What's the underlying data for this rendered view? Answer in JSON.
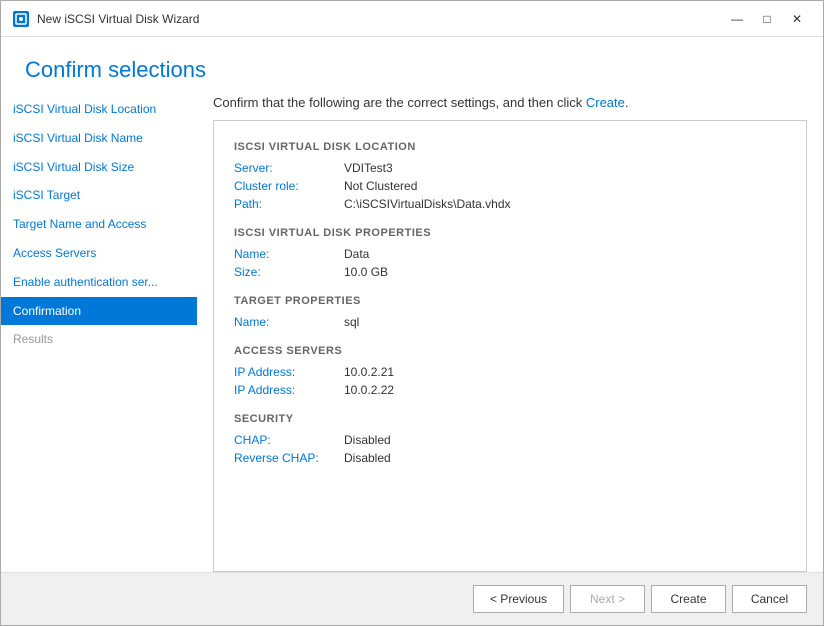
{
  "window": {
    "title": "New iSCSI Virtual Disk Wizard",
    "icon": "💾"
  },
  "header": {
    "title": "Confirm selections"
  },
  "instruction": {
    "text": "Confirm that the following are the correct settings, and then click ",
    "link_text": "Create",
    "text_end": "."
  },
  "sidebar": {
    "items": [
      {
        "id": "iscsi-virtual-disk-location",
        "label": "iSCSI Virtual Disk Location",
        "state": "normal"
      },
      {
        "id": "iscsi-virtual-disk-name",
        "label": "iSCSI Virtual Disk Name",
        "state": "normal"
      },
      {
        "id": "iscsi-virtual-disk-size",
        "label": "iSCSI Virtual Disk Size",
        "state": "normal"
      },
      {
        "id": "iscsi-target",
        "label": "iSCSI Target",
        "state": "normal"
      },
      {
        "id": "target-name-and-access",
        "label": "Target Name and Access",
        "state": "normal"
      },
      {
        "id": "access-servers",
        "label": "Access Servers",
        "state": "normal"
      },
      {
        "id": "enable-authentication",
        "label": "Enable authentication ser...",
        "state": "normal"
      },
      {
        "id": "confirmation",
        "label": "Confirmation",
        "state": "active"
      },
      {
        "id": "results",
        "label": "Results",
        "state": "inactive"
      }
    ]
  },
  "summary": {
    "sections": [
      {
        "id": "iscsi-virtual-disk-location-section",
        "header": "ISCSI VIRTUAL DISK LOCATION",
        "properties": [
          {
            "label": "Server:",
            "value": "VDITest3"
          },
          {
            "label": "Cluster role:",
            "value": "Not Clustered"
          },
          {
            "label": "Path:",
            "value": "C:\\iSCSIVirtualDisks\\Data.vhdx"
          }
        ]
      },
      {
        "id": "iscsi-virtual-disk-properties-section",
        "header": "ISCSI VIRTUAL DISK PROPERTIES",
        "properties": [
          {
            "label": "Name:",
            "value": "Data"
          },
          {
            "label": "Size:",
            "value": "10.0 GB"
          }
        ]
      },
      {
        "id": "target-properties-section",
        "header": "TARGET PROPERTIES",
        "properties": [
          {
            "label": "Name:",
            "value": "sql"
          }
        ]
      },
      {
        "id": "access-servers-section",
        "header": "ACCESS SERVERS",
        "properties": [
          {
            "label": "IP Address:",
            "value": "10.0.2.21"
          },
          {
            "label": "IP Address:",
            "value": "10.0.2.22"
          }
        ]
      },
      {
        "id": "security-section",
        "header": "SECURITY",
        "properties": [
          {
            "label": "CHAP:",
            "value": "Disabled"
          },
          {
            "label": "Reverse CHAP:",
            "value": "Disabled"
          }
        ]
      }
    ]
  },
  "footer": {
    "previous_label": "< Previous",
    "next_label": "Next >",
    "create_label": "Create",
    "cancel_label": "Cancel"
  },
  "title_bar_controls": {
    "minimize": "—",
    "maximize": "□",
    "close": "✕"
  }
}
